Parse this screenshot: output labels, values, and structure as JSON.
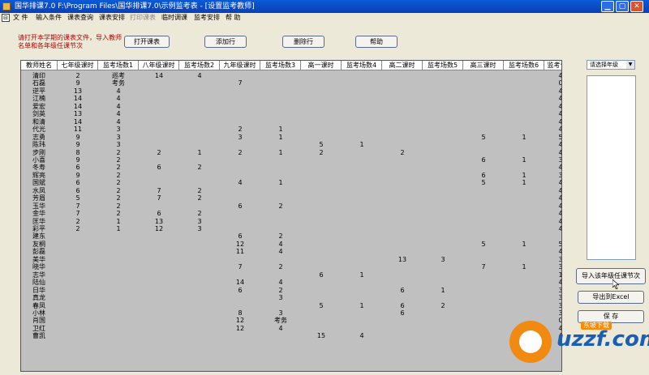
{
  "window": {
    "title": "国华排课7.0 F:\\Program Files\\国华排课7.0\\示例监考表 - [设置监考教师]",
    "min_label": "▁",
    "max_label": "▢",
    "close_label": "✕"
  },
  "menu": {
    "icon_label": "⊟",
    "items": [
      "文 件",
      "输入条件",
      "课表查询",
      "课表安排",
      "打印课表",
      "临时调课",
      "监考安排",
      "帮 助"
    ]
  },
  "hint": "请打开本学期的课表文件，导入教师名单和各年级任课节次",
  "buttons": {
    "open": "打开课表",
    "add": "添加行",
    "delete": "删除行",
    "help": "帮助",
    "import": "导入该年级任课节次",
    "export": "导出到Excel",
    "save": "保 存"
  },
  "combo": {
    "placeholder": "请选择年级",
    "arrow": "▼"
  },
  "table": {
    "columns": [
      "教师姓名",
      "七年级课时",
      "监考场数1",
      "八年级课时",
      "监考场数2",
      "九年级课时",
      "监考场数3",
      "高一课时",
      "监考场数4",
      "高二课时",
      "监考场数5",
      "高三课时",
      "监考场数6",
      "监考合计"
    ],
    "rows": [
      [
        "清印",
        "2",
        "巡考",
        "14",
        "4",
        "",
        "",
        "",
        "",
        "",
        "",
        "",
        "",
        "4"
      ],
      [
        "石磊",
        "9",
        "考务",
        "",
        "",
        "7",
        "",
        "",
        "",
        "",
        "",
        "",
        "",
        "0"
      ],
      [
        "逆平",
        "13",
        "4",
        "",
        "",
        "",
        "",
        "",
        "",
        "",
        "",
        "",
        "",
        "4"
      ],
      [
        "江楠",
        "14",
        "4",
        "",
        "",
        "",
        "",
        "",
        "",
        "",
        "",
        "",
        "",
        "4"
      ],
      [
        "爱宏",
        "14",
        "4",
        "",
        "",
        "",
        "",
        "",
        "",
        "",
        "",
        "",
        "",
        "4"
      ],
      [
        "剑英",
        "13",
        "4",
        "",
        "",
        "",
        "",
        "",
        "",
        "",
        "",
        "",
        "",
        "4"
      ],
      [
        "和清",
        "14",
        "4",
        "",
        "",
        "",
        "",
        "",
        "",
        "",
        "",
        "",
        "",
        "4"
      ],
      [
        "代光",
        "11",
        "3",
        "",
        "",
        "2",
        "1",
        "",
        "",
        "",
        "",
        "",
        "",
        "4"
      ],
      [
        "志勇",
        "9",
        "3",
        "",
        "",
        "3",
        "1",
        "",
        "",
        "",
        "",
        "5",
        "1",
        "5"
      ],
      [
        "陈玮",
        "9",
        "3",
        "",
        "",
        "",
        "",
        "5",
        "1",
        "",
        "",
        "",
        "",
        "4"
      ],
      [
        "步刚",
        "8",
        "2",
        "2",
        "1",
        "2",
        "1",
        "2",
        "",
        "2",
        "",
        "",
        "",
        "4"
      ],
      [
        "小喜",
        "9",
        "2",
        "",
        "",
        "",
        "",
        "",
        "",
        "",
        "",
        "6",
        "1",
        "3"
      ],
      [
        "冬寿",
        "6",
        "2",
        "6",
        "2",
        "",
        "",
        "",
        "",
        "",
        "",
        "",
        "",
        "4"
      ],
      [
        "辉亮",
        "9",
        "2",
        "",
        "",
        "",
        "",
        "",
        "",
        "",
        "",
        "6",
        "1",
        "3"
      ],
      [
        "国斌",
        "6",
        "2",
        "",
        "",
        "4",
        "1",
        "",
        "",
        "",
        "",
        "5",
        "1",
        "4"
      ],
      [
        "水凤",
        "6",
        "2",
        "7",
        "2",
        "",
        "",
        "",
        "",
        "",
        "",
        "",
        "",
        "4"
      ],
      [
        "芳眉",
        "5",
        "2",
        "7",
        "2",
        "",
        "",
        "",
        "",
        "",
        "",
        "",
        "",
        "4"
      ],
      [
        "玉华",
        "7",
        "2",
        "",
        "",
        "6",
        "2",
        "",
        "",
        "",
        "",
        "",
        "",
        "4"
      ],
      [
        "金华",
        "7",
        "2",
        "6",
        "2",
        "",
        "",
        "",
        "",
        "",
        "",
        "",
        "",
        "4"
      ],
      [
        "匡华",
        "2",
        "1",
        "13",
        "3",
        "",
        "",
        "",
        "",
        "",
        "",
        "",
        "",
        "4"
      ],
      [
        "彩平",
        "2",
        "1",
        "12",
        "3",
        "",
        "",
        "",
        "",
        "",
        "",
        "",
        "",
        "4"
      ],
      [
        "建东",
        "",
        "",
        "",
        "",
        "6",
        "2",
        "",
        "",
        "",
        "",
        "",
        "",
        "",
        "2"
      ],
      [
        "友桐",
        "",
        "",
        "",
        "",
        "12",
        "4",
        "",
        "",
        "",
        "",
        "5",
        "1",
        "5"
      ],
      [
        "彭磊",
        "",
        "",
        "",
        "",
        "11",
        "4",
        "",
        "",
        "",
        "",
        "",
        "",
        "4"
      ],
      [
        "美华",
        "",
        "",
        "",
        "",
        "",
        "",
        "",
        "",
        "13",
        "3",
        "",
        "",
        "3"
      ],
      [
        "晓华",
        "",
        "",
        "",
        "",
        "7",
        "2",
        "",
        "",
        "",
        "",
        "7",
        "1",
        "3"
      ],
      [
        "志华",
        "",
        "",
        "",
        "",
        "",
        "",
        "6",
        "1",
        "",
        "",
        "",
        "",
        "1"
      ],
      [
        "陆仙",
        "",
        "",
        "",
        "",
        "14",
        "4",
        "",
        "",
        "",
        "",
        "",
        "",
        "4"
      ],
      [
        "日华",
        "",
        "",
        "",
        "",
        "6",
        "2",
        "",
        "",
        "6",
        "1",
        "",
        "",
        "3"
      ],
      [
        "真龙",
        "",
        "",
        "",
        "",
        "",
        "3",
        "",
        "",
        "",
        "",
        "",
        "",
        "3"
      ],
      [
        "春凤",
        "",
        "",
        "",
        "",
        "",
        "",
        "5",
        "1",
        "6",
        "2",
        "",
        "",
        "3"
      ],
      [
        "小林",
        "",
        "",
        "",
        "",
        "8",
        "3",
        "",
        "",
        "6",
        "",
        "",
        "",
        "3"
      ],
      [
        "肖国",
        "",
        "",
        "",
        "",
        "12",
        "考务",
        "",
        "",
        "",
        "",
        "",
        "",
        "0"
      ],
      [
        "卫红",
        "",
        "",
        "",
        "",
        "12",
        "4",
        "",
        "",
        "",
        "",
        "",
        "",
        "4"
      ],
      [
        "曹凯",
        "",
        "",
        "",
        "",
        "",
        "",
        "15",
        "4",
        "",
        "",
        "",
        "",
        "4"
      ]
    ]
  },
  "watermark": {
    "text": "uzzf.com",
    "tag": "东坡下载"
  }
}
